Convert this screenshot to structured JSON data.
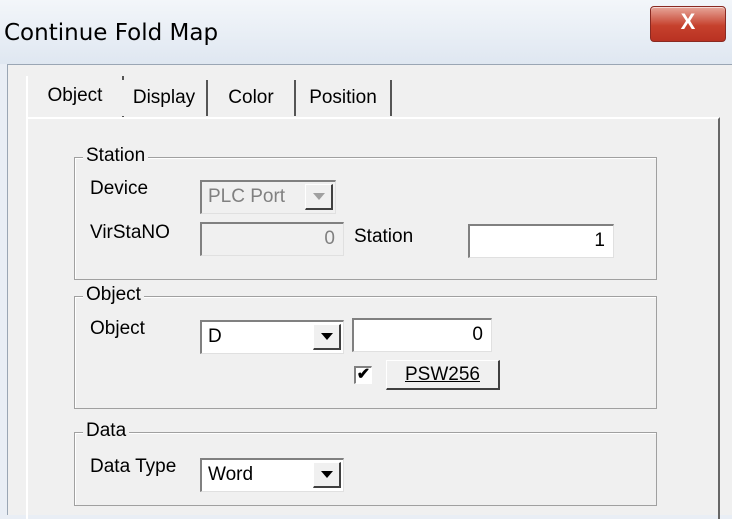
{
  "window": {
    "title": "Continue Fold Map",
    "close_glyph": "X"
  },
  "tabs": [
    {
      "label": "Object",
      "active": true
    },
    {
      "label": "Display",
      "active": false
    },
    {
      "label": "Color",
      "active": false
    },
    {
      "label": "Position",
      "active": false
    }
  ],
  "station_group": {
    "legend": "Station",
    "device_label": "Device",
    "device_value": "PLC Port",
    "virsta_label": "VirStaNO",
    "virsta_value": "0",
    "station_label": "Station",
    "station_value": "1"
  },
  "object_group": {
    "legend": "Object",
    "object_label": "Object",
    "object_type": "D",
    "object_address": "0",
    "checkbox_checked": true,
    "checkbox_mark": "✔",
    "psw_button": "PSW256"
  },
  "data_group": {
    "legend": "Data",
    "type_label": "Data Type",
    "type_value": "Word"
  }
}
